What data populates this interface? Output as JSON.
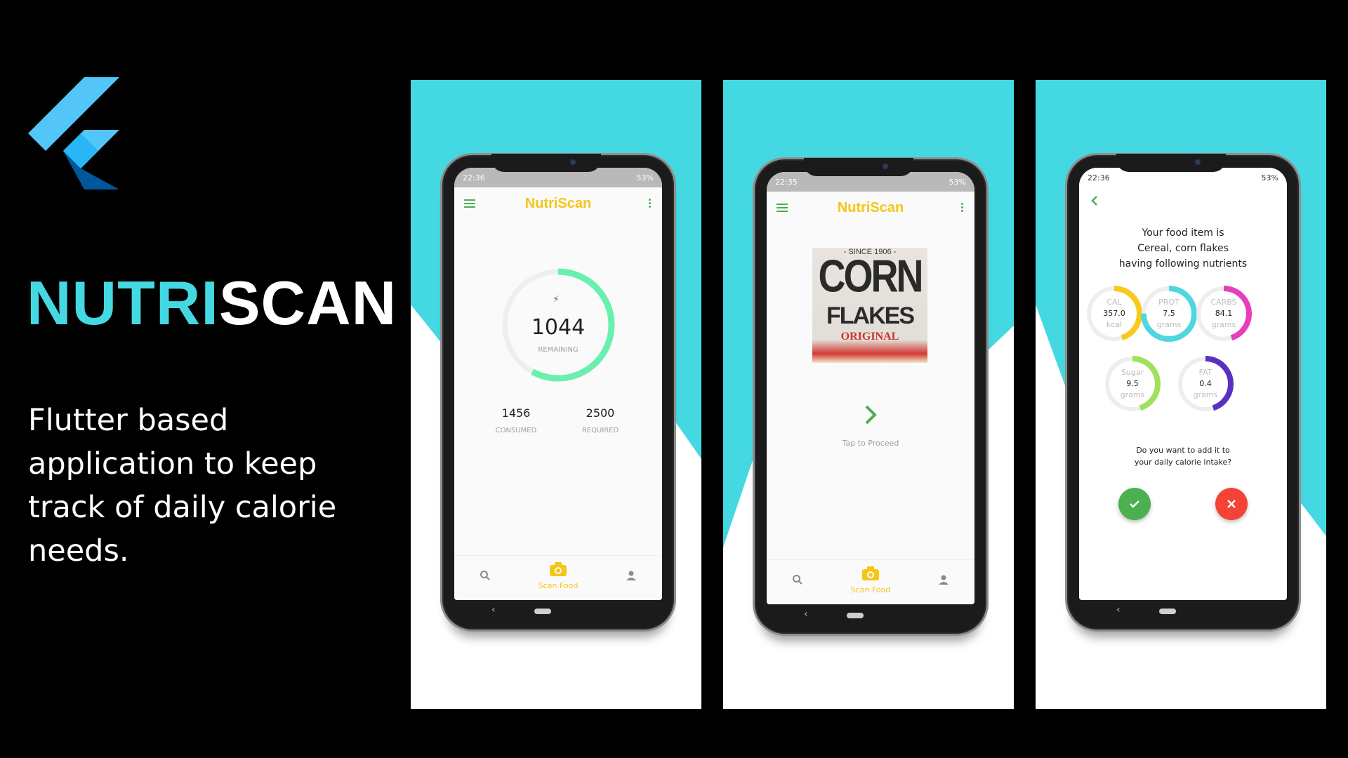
{
  "brand": {
    "title_part1": "NUTRI",
    "title_part2": "SCAN",
    "description": "Flutter based application to keep track of daily calorie needs.",
    "colors": {
      "cyan": "#44d9e2",
      "white": "#ffffff",
      "accent_yellow": "#f5c518",
      "green": "#4caf50",
      "red": "#f44336"
    },
    "logo_icon": "flutter-logo-icon"
  },
  "common": {
    "app_title": "NutriScan",
    "nav_scan_label": "Scan Food",
    "battery": "53%"
  },
  "screen1": {
    "time": "22:36",
    "remaining_value": "1044",
    "remaining_label": "REMAINING",
    "consumed_value": "1456",
    "consumed_label": "CONSUMED",
    "required_value": "2500",
    "required_label": "REQUIRED",
    "ring_fraction": 0.58
  },
  "screen2": {
    "time": "22:35",
    "cereal_since": "- SINCE 1906 -",
    "cereal_word1": "CORN",
    "cereal_word2": "FLAKES",
    "cereal_word3": "ORIGINAL",
    "proceed_label": "Tap to Proceed"
  },
  "screen3": {
    "time": "22:36",
    "line1": "Your food item is",
    "line2": "Cereal, corn flakes",
    "line3": "having following nutrients",
    "nutrients": [
      {
        "name": "CAL",
        "value": "357.0",
        "unit": "kcal",
        "fraction": 0.45,
        "color": "#f9c91d"
      },
      {
        "name": "PROT",
        "value": "7.5",
        "unit": "grams",
        "fraction": 0.75,
        "color": "#4fd6e0"
      },
      {
        "name": "CARBS",
        "value": "84.1",
        "unit": "grams",
        "fraction": 0.45,
        "color": "#e63fbc"
      },
      {
        "name": "Sugar",
        "value": "9.5",
        "unit": "grams",
        "fraction": 0.45,
        "color": "#9de15c"
      },
      {
        "name": "FAT",
        "value": "0.4",
        "unit": "grams",
        "fraction": 0.45,
        "color": "#5a30c2"
      }
    ],
    "question_line1": "Do you want to add it to",
    "question_line2": "your daily calorie intake?"
  }
}
